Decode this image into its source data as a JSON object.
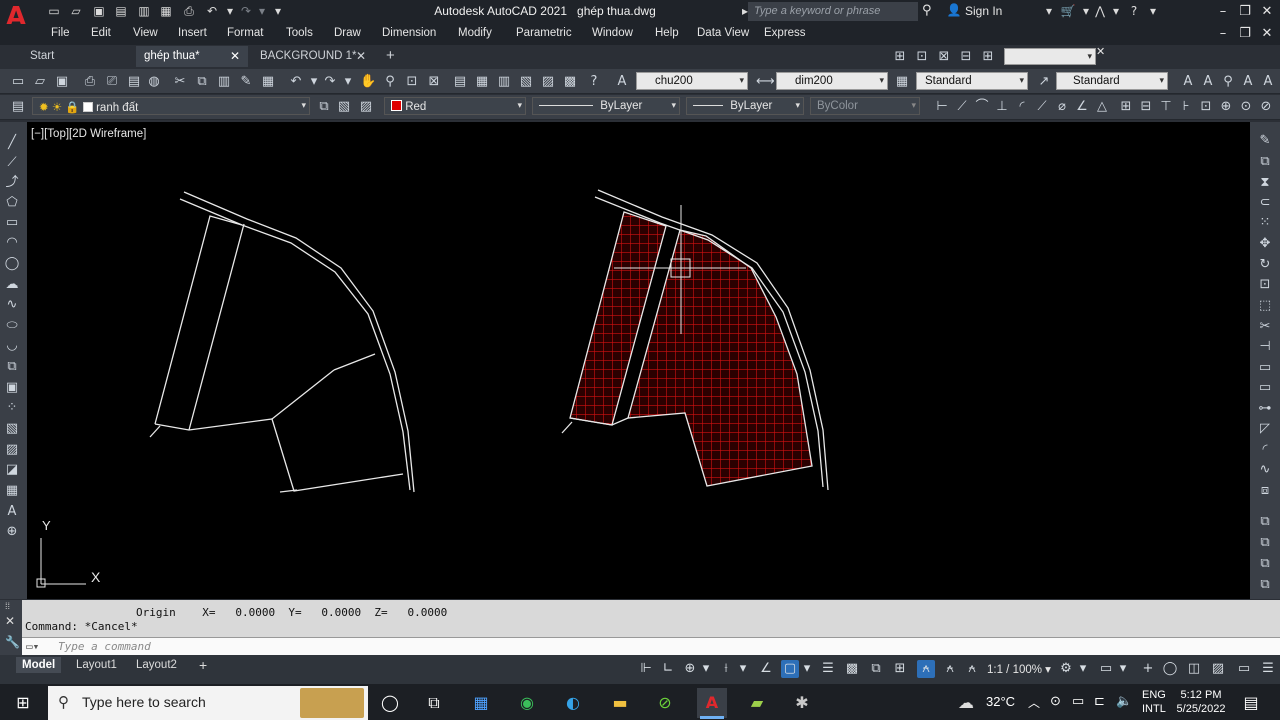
{
  "window": {
    "title": "Autodesk AutoCAD 2021",
    "filename": "ghép thua.dwg",
    "search_placeholder": "Type a keyword or phrase",
    "sign_in": "Sign In"
  },
  "menu": [
    "File",
    "Edit",
    "View",
    "Insert",
    "Format",
    "Tools",
    "Draw",
    "Dimension",
    "Modify",
    "Parametric",
    "Window",
    "Help",
    "Data View",
    "Express"
  ],
  "tabs": {
    "start": "Start",
    "active": "ghép thua*",
    "background": "BACKGROUND 1*",
    "add": "+"
  },
  "toolbar1": {
    "text_style": "chu200",
    "dim_style": "dim200",
    "table_style": "Standard",
    "multileader_style": "Standard"
  },
  "toolbar2": {
    "layer": "ranh đất",
    "color": "Red",
    "color_hex": "#e00000",
    "linetype": "ByLayer",
    "lineweight": "ByLayer",
    "plot_style": "ByColor"
  },
  "viewport": {
    "label": "[−][Top][2D Wireframe]",
    "ucs_y": "Y",
    "ucs_x": "X"
  },
  "command": {
    "coords_line": "Origin    X=   0.0000  Y=   0.0000  Z=   0.0000",
    "last": "Command: *Cancel*",
    "placeholder": "Type a command"
  },
  "layouts": [
    "Model",
    "Layout1",
    "Layout2"
  ],
  "status": {
    "scale": "1:1 / 100%"
  },
  "taskbar": {
    "search": "Type here to search",
    "weather": "32°C",
    "lang1": "ENG",
    "lang2": "INTL",
    "time": "5:12 PM",
    "date": "5/25/2022"
  },
  "colors": {
    "accent_red": "#e0282d",
    "hatch": "#cc1010"
  }
}
